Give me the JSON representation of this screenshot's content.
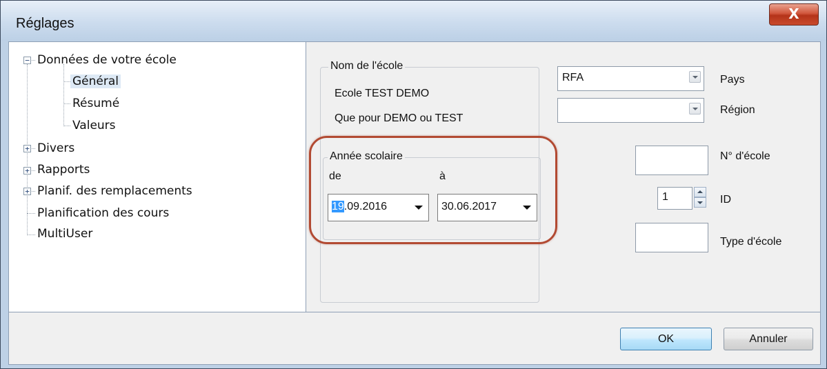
{
  "window": {
    "title": "Réglages",
    "close_label": "X"
  },
  "tree": {
    "items": [
      {
        "label": "Données de votre école",
        "expander": "−"
      },
      {
        "label": "Général"
      },
      {
        "label": "Résumé"
      },
      {
        "label": "Valeurs"
      },
      {
        "label": "Divers",
        "expander": "+"
      },
      {
        "label": "Rapports",
        "expander": "+"
      },
      {
        "label": "Planif. des remplacements",
        "expander": "+"
      },
      {
        "label": "Planification des cours"
      },
      {
        "label": "MultiUser"
      }
    ],
    "selected": "Général"
  },
  "school": {
    "group_label": "Nom de l'école",
    "name_line1": "Ecole TEST  DEMO",
    "name_line2": "Que pour DEMO ou TEST"
  },
  "school_year": {
    "group_label": "Année scolaire",
    "from_label": "de",
    "to_label": "à",
    "from_selected": "19",
    "from_rest": ".09.2016",
    "to_value": "30.06.2017"
  },
  "fields": {
    "country_value": "RFA",
    "country_label": "Pays",
    "region_value": "",
    "region_label": "Région",
    "school_no_value": "",
    "school_no_label": "N° d'école",
    "id_value": "1",
    "id_label": "ID",
    "school_type_value": "",
    "school_type_label": "Type d'école"
  },
  "buttons": {
    "ok": "OK",
    "cancel": "Annuler"
  },
  "colors": {
    "highlight_ring": "#b24a32",
    "selection": "#3399ff",
    "close_button": "#c94b2d"
  }
}
